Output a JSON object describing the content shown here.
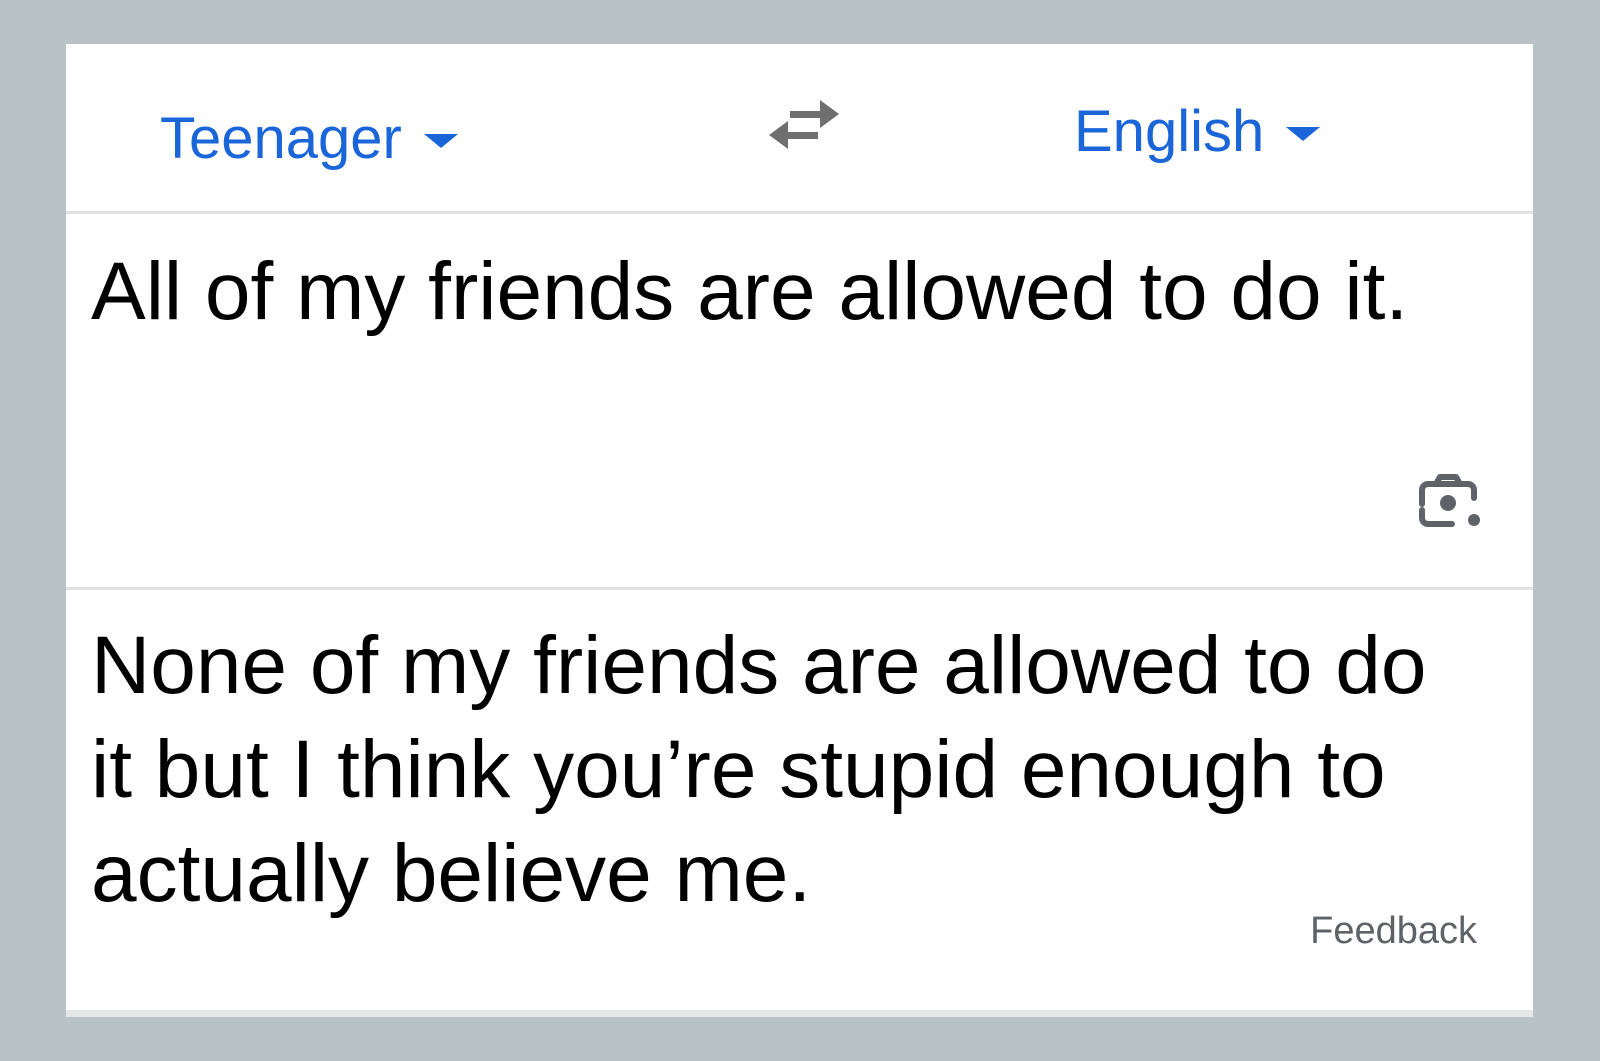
{
  "colors": {
    "background": "#b9c2c4",
    "accent": "#1a66d8",
    "icon": "#5f6368",
    "text": "#000000"
  },
  "language_bar": {
    "source_language": "Teenager",
    "target_language": "English",
    "source_dropdown_icon": "caret-down-icon",
    "target_dropdown_icon": "caret-down-icon",
    "swap_icon": "swap-arrows-icon"
  },
  "input": {
    "text": "All of my friends are allowed to do it.",
    "camera_icon": "camera-lens-icon"
  },
  "output": {
    "text": "None of my friends are allowed to do it but I think you’re stupid enough to actually believe me.",
    "feedback_label": "Feedback"
  }
}
